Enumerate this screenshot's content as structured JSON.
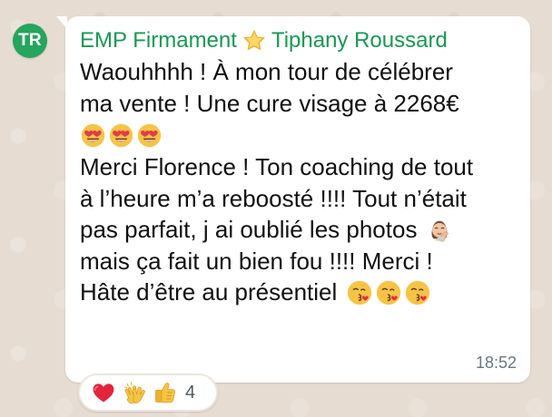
{
  "avatar": {
    "initials": "TR"
  },
  "message": {
    "sender_group": "EMP Firmament",
    "sender_name": "Tiphany Roussard",
    "lines": [
      "Waouhhhh ! À mon tour de célébrer",
      "ma vente ! Une cure visage à 2268€",
      "",
      "Merci Florence ! Ton coaching de tout",
      "à l’heure m’a reboosté !!!! Tout n’était",
      "pas parfait, j ai oublié les photos",
      "mais ça fait un bien fou !!!! Merci !",
      "Hâte d’être au présentiel"
    ],
    "timestamp": "18:52",
    "emojis": {
      "row_2": [
        "heart-eyes-icon",
        "heart-eyes-icon",
        "heart-eyes-icon"
      ],
      "photo_line": "facepalm-woman-icon",
      "last_line": [
        "kissing-face-icon",
        "kissing-face-icon",
        "kissing-face-icon"
      ]
    }
  },
  "reactions": {
    "icons": [
      "red-heart-icon",
      "clapping-hands-icon",
      "thumbs-up-icon"
    ],
    "count": "4"
  },
  "colors": {
    "sender_green": "#169a52",
    "avatar_bg": "#25a55d",
    "bubble_bg": "#ffffff",
    "background": "#e7ddd3",
    "timestamp": "#667781"
  }
}
